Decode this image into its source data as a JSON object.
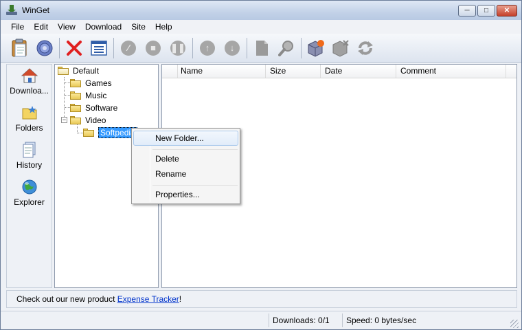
{
  "window": {
    "title": "WinGet"
  },
  "menubar": [
    "File",
    "Edit",
    "View",
    "Download",
    "Site",
    "Help"
  ],
  "sidebar": {
    "items": [
      {
        "label": "Downloa...",
        "icon": "house-icon"
      },
      {
        "label": "Folders",
        "icon": "folder-star-icon"
      },
      {
        "label": "History",
        "icon": "document-icon"
      },
      {
        "label": "Explorer",
        "icon": "globe-icon"
      }
    ]
  },
  "tree": {
    "root": "Default",
    "children": [
      "Games",
      "Music",
      "Software",
      "Video"
    ],
    "video_child": "Softpedia"
  },
  "list": {
    "columns": [
      "Name",
      "Size",
      "Date",
      "Comment"
    ]
  },
  "context_menu": {
    "items": [
      "New Folder...",
      "Delete",
      "Rename",
      "Properties..."
    ]
  },
  "adbar": {
    "text": "Check out our new product ",
    "link": "Expense Tracker",
    "suffix": "!"
  },
  "status": {
    "downloads": "Downloads: 0/1",
    "speed": "Speed: 0 bytes/sec"
  },
  "colors": {
    "selection": "#3399ff",
    "link": "#0033cc",
    "delete_red": "#e02020"
  }
}
